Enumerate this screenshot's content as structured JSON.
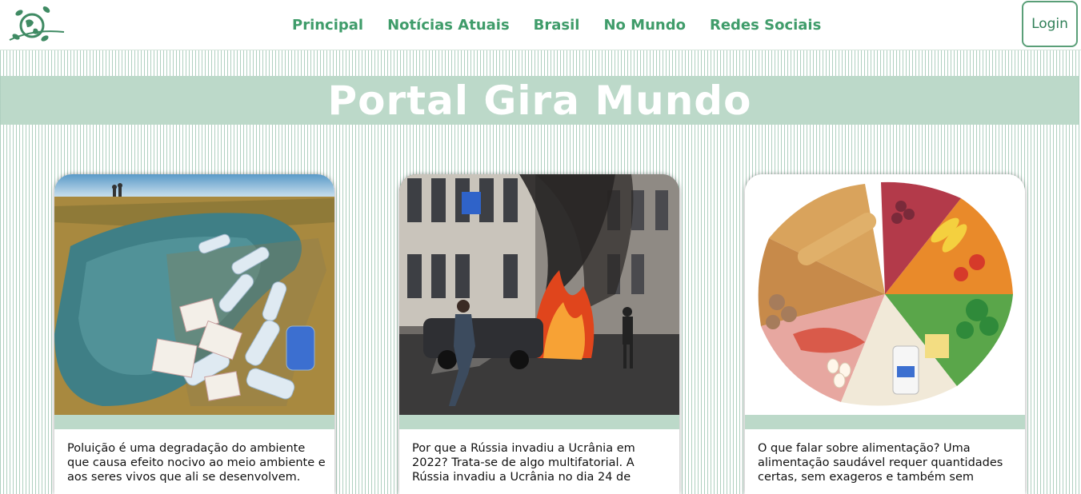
{
  "nav": {
    "links": [
      "Principal",
      "Notícias Atuais",
      "Brasil",
      "No Mundo",
      "Redes Sociais"
    ],
    "login_label": "Login"
  },
  "banner": {
    "title": "Portal Gira Mundo"
  },
  "cards": [
    {
      "image": "photo-plastic-pollution",
      "text": "Poluição é uma degradação do ambiente que causa efeito nocivo ao meio ambiente e aos seres vivos que ali se desenvolvem."
    },
    {
      "image": "photo-ukraine-explosion",
      "text": "Por que a Rússia invadiu a Ucrânia em 2022? Trata-se de algo multifatorial. A Rússia invadiu a Ucrânia no dia 24 de"
    },
    {
      "image": "photo-food-wheel",
      "text": "O que falar sobre alimentação? Uma alimentação saudável requer quantidades certas, sem exageros e também sem"
    }
  ],
  "colors": {
    "accent": "#3f9c6a",
    "banner": "#bcd9c9",
    "login_border": "#5a9f78"
  }
}
